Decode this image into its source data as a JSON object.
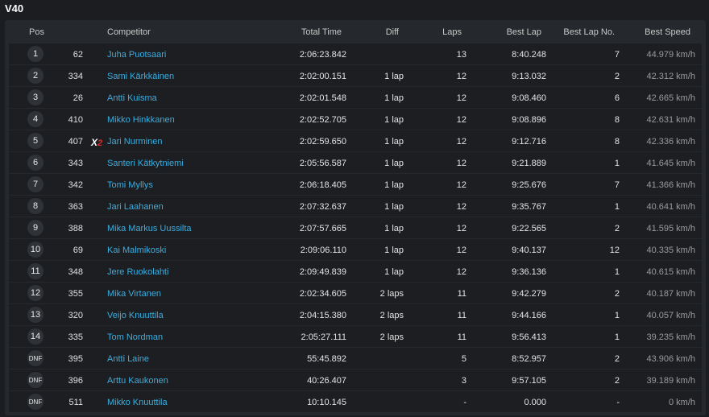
{
  "class_title": "V40",
  "columns": {
    "pos": "Pos",
    "competitor": "Competitor",
    "total_time": "Total Time",
    "diff": "Diff",
    "laps": "Laps",
    "best_lap": "Best Lap",
    "best_lap_no": "Best Lap No.",
    "best_speed": "Best Speed"
  },
  "penalty_marker": {
    "letter": "X",
    "count": "2"
  },
  "rows": [
    {
      "pos": "1",
      "num": "62",
      "name": "Juha Puotsaari",
      "time": "2:06:23.842",
      "diff": "",
      "laps": "13",
      "best": "8:40.248",
      "best_no": "7",
      "speed": "44.979 km/h"
    },
    {
      "pos": "2",
      "num": "334",
      "name": "Sami Kärkkäinen",
      "time": "2:02:00.151",
      "diff": "1 lap",
      "laps": "12",
      "best": "9:13.032",
      "best_no": "2",
      "speed": "42.312 km/h"
    },
    {
      "pos": "3",
      "num": "26",
      "name": "Antti Kuisma",
      "time": "2:02:01.548",
      "diff": "1 lap",
      "laps": "12",
      "best": "9:08.460",
      "best_no": "6",
      "speed": "42.665 km/h"
    },
    {
      "pos": "4",
      "num": "410",
      "name": "Mikko Hinkkanen",
      "time": "2:02:52.705",
      "diff": "1 lap",
      "laps": "12",
      "best": "9:08.896",
      "best_no": "8",
      "speed": "42.631 km/h"
    },
    {
      "pos": "5",
      "num": "407",
      "name": "Jari Nurminen",
      "time": "2:02:59.650",
      "diff": "1 lap",
      "laps": "12",
      "best": "9:12.716",
      "best_no": "8",
      "speed": "42.336 km/h",
      "penalty": true
    },
    {
      "pos": "6",
      "num": "343",
      "name": "Santeri Kätkytniemi",
      "time": "2:05:56.587",
      "diff": "1 lap",
      "laps": "12",
      "best": "9:21.889",
      "best_no": "1",
      "speed": "41.645 km/h"
    },
    {
      "pos": "7",
      "num": "342",
      "name": "Tomi Myllys",
      "time": "2:06:18.405",
      "diff": "1 lap",
      "laps": "12",
      "best": "9:25.676",
      "best_no": "7",
      "speed": "41.366 km/h"
    },
    {
      "pos": "8",
      "num": "363",
      "name": "Jari Laahanen",
      "time": "2:07:32.637",
      "diff": "1 lap",
      "laps": "12",
      "best": "9:35.767",
      "best_no": "1",
      "speed": "40.641 km/h"
    },
    {
      "pos": "9",
      "num": "388",
      "name": "Mika Markus Uussilta",
      "time": "2:07:57.665",
      "diff": "1 lap",
      "laps": "12",
      "best": "9:22.565",
      "best_no": "2",
      "speed": "41.595 km/h"
    },
    {
      "pos": "10",
      "num": "69",
      "name": "Kai Malmikoski",
      "time": "2:09:06.110",
      "diff": "1 lap",
      "laps": "12",
      "best": "9:40.137",
      "best_no": "12",
      "speed": "40.335 km/h"
    },
    {
      "pos": "11",
      "num": "348",
      "name": "Jere Ruokolahti",
      "time": "2:09:49.839",
      "diff": "1 lap",
      "laps": "12",
      "best": "9:36.136",
      "best_no": "1",
      "speed": "40.615 km/h"
    },
    {
      "pos": "12",
      "num": "355",
      "name": "Mika Virtanen",
      "time": "2:02:34.605",
      "diff": "2 laps",
      "laps": "11",
      "best": "9:42.279",
      "best_no": "2",
      "speed": "40.187 km/h"
    },
    {
      "pos": "13",
      "num": "320",
      "name": "Veijo Knuuttila",
      "time": "2:04:15.380",
      "diff": "2 laps",
      "laps": "11",
      "best": "9:44.166",
      "best_no": "1",
      "speed": "40.057 km/h"
    },
    {
      "pos": "14",
      "num": "335",
      "name": "Tom Nordman",
      "time": "2:05:27.111",
      "diff": "2 laps",
      "laps": "11",
      "best": "9:56.413",
      "best_no": "1",
      "speed": "39.235 km/h"
    },
    {
      "pos": "DNF",
      "num": "395",
      "name": "Antti Laine",
      "time": "55:45.892",
      "diff": "",
      "laps": "5",
      "best": "8:52.957",
      "best_no": "2",
      "speed": "43.906 km/h"
    },
    {
      "pos": "DNF",
      "num": "396",
      "name": "Arttu Kaukonen",
      "time": "40:26.407",
      "diff": "",
      "laps": "3",
      "best": "9:57.105",
      "best_no": "2",
      "speed": "39.189 km/h"
    },
    {
      "pos": "DNF",
      "num": "511",
      "name": "Mikko Knuuttila",
      "time": "10:10.145",
      "diff": "",
      "laps": "-",
      "best": "0.000",
      "best_no": "-",
      "speed": "0 km/h"
    }
  ]
}
